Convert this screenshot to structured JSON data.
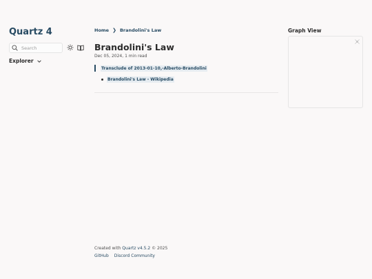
{
  "sidebar": {
    "site_title": "Quartz 4",
    "search_placeholder": "Search",
    "explorer_label": "Explorer"
  },
  "breadcrumb": {
    "items": [
      "Home",
      "Brandolini's Law"
    ],
    "separator": "❯"
  },
  "article": {
    "title": "Brandolini's Law",
    "date": "Dec 05, 2024",
    "reading_time": "1 min read",
    "transclude_link": "Transclude of 2013-01-10,-Alberto-Brandolini",
    "list_items": [
      "Brandolini's Law - Wikipedia"
    ]
  },
  "graph": {
    "title": "Graph View"
  },
  "footer": {
    "credit_prefix": "Created with ",
    "credit_link": "Quartz v4.5.2",
    "credit_suffix": " © 2025",
    "links": [
      "GitHub",
      "Discord Community"
    ]
  },
  "colors": {
    "accent": "#284b63",
    "background": "#faf8f8",
    "highlight": "#e6ecf1",
    "text": "#2b2b2b"
  }
}
